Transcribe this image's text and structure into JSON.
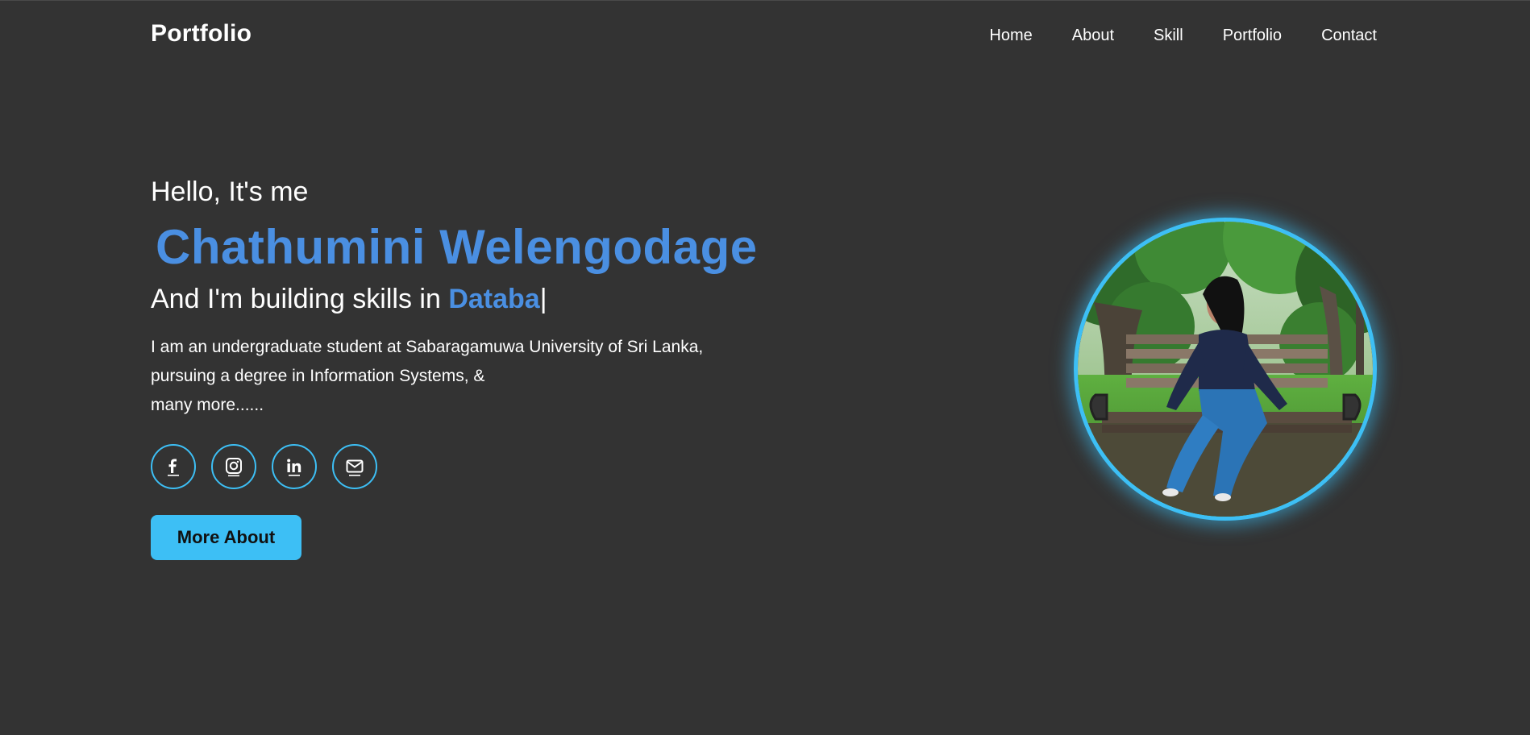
{
  "header": {
    "logo": "Portfolio",
    "nav": [
      {
        "label": "Home"
      },
      {
        "label": "About"
      },
      {
        "label": "Skill"
      },
      {
        "label": "Portfolio"
      },
      {
        "label": "Contact"
      }
    ]
  },
  "hero": {
    "greeting": "Hello, It's me",
    "name": "Chathumini Welengodage",
    "skills_prefix": "And I'm building skills in ",
    "skills_typed": "Databa",
    "caret": "|",
    "bio_lines": [
      "I am an undergraduate student at Sabaragamuwa University of Sri Lanka,",
      "pursuing a degree in Information Systems, &",
      "many more......"
    ],
    "socials": [
      {
        "icon": "facebook-icon"
      },
      {
        "icon": "instagram-icon"
      },
      {
        "icon": "linkedin-icon"
      },
      {
        "icon": "email-icon"
      }
    ],
    "button_label": "More About"
  },
  "colors": {
    "background": "#333333",
    "accent_blue": "#4a8fe2",
    "accent_cyan": "#3dbff5",
    "text": "#ffffff"
  }
}
